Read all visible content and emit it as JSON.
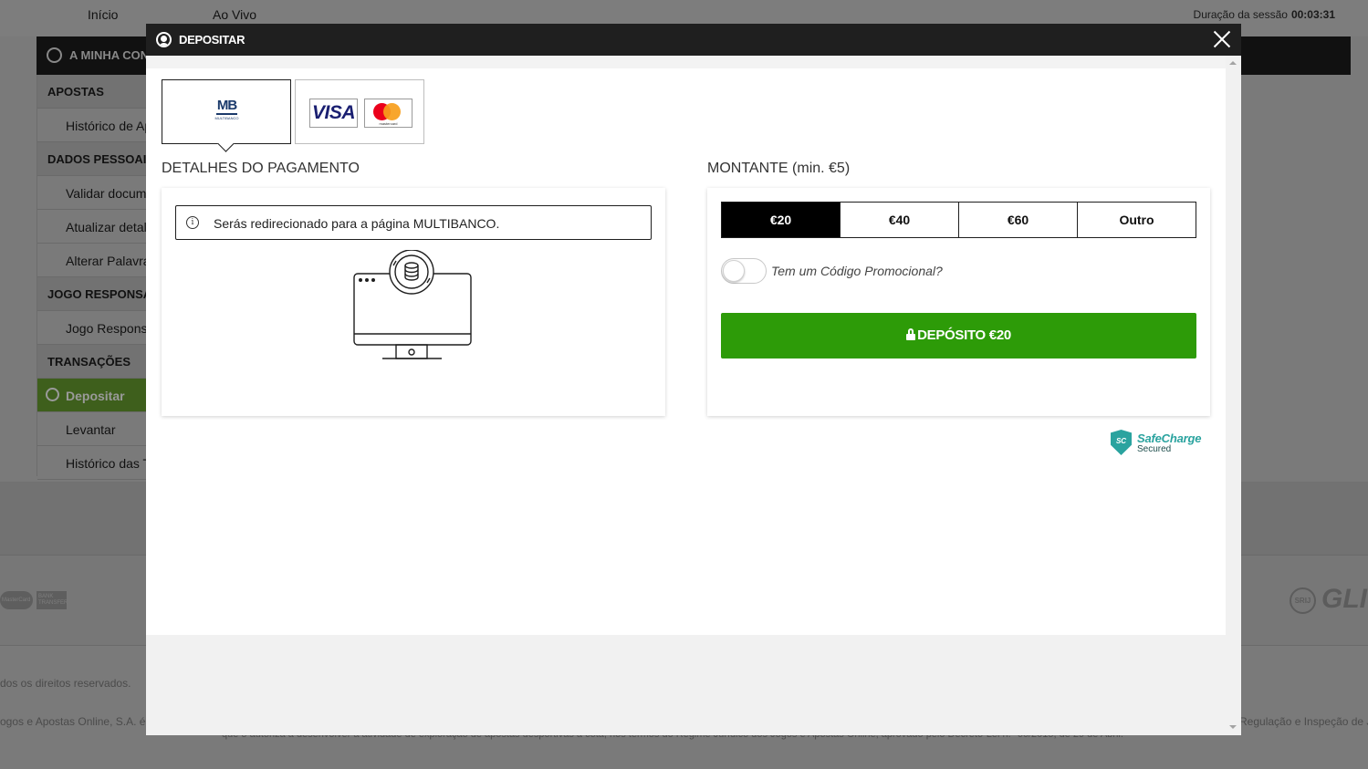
{
  "background": {
    "nav": [
      "Início",
      "Ao Vivo"
    ],
    "session_label": "Duração da sessão",
    "session_time": "00:03:31",
    "account_title": "A MINHA CONTA",
    "sidebar": [
      {
        "label": "APOSTAS",
        "type": "head"
      },
      {
        "label": "Histórico de Apostas",
        "type": "item"
      },
      {
        "label": "DADOS PESSOAIS",
        "type": "head"
      },
      {
        "label": "Validar documentos",
        "type": "item"
      },
      {
        "label": "Atualizar detalhes",
        "type": "item"
      },
      {
        "label": "Alterar Palavra-passe",
        "type": "item"
      },
      {
        "label": "JOGO RESPONSÁVEL",
        "type": "head"
      },
      {
        "label": "Jogo Responsável",
        "type": "item"
      },
      {
        "label": "TRANSAÇÕES",
        "type": "head"
      },
      {
        "label": "Depositar",
        "type": "active"
      },
      {
        "label": "Levantar",
        "type": "item"
      },
      {
        "label": "Histórico das Transações",
        "type": "item"
      }
    ],
    "footer_rights": "dos os direitos reservados.",
    "footer_legal_left": "ogos e Apostas Online, S.A. é u",
    "footer_legal_right": "Regulação e Inspeção de Jo",
    "footer_legal_faded": "que o autoriza a desenvolver a atividade de exploração de apostas desportivas à cota, nos termos do Regime Jurídico dos Jogos e Apostas Online, aprovado pelo Decreto-Lei n.º 66/2015, de 29 de Abril.",
    "mastercard_label": "MasterCard",
    "bank_label": "BANK TRANSFER",
    "gli_label": "GLI",
    "srij_label": "SRIJ"
  },
  "modal": {
    "title": "DEPOSITAR",
    "payment_methods": [
      {
        "name": "Multibanco",
        "logo_text": "MB",
        "logo_sub": "MULTIBANCO",
        "selected": true
      },
      {
        "name": "Visa / Mastercard",
        "visa": "VISA",
        "mastercard": "mastercard",
        "selected": false
      }
    ],
    "payment_details_title": "DETALHES DO PAGAMENTO",
    "info_message": "Serás redirecionado para a página MULTIBANCO.",
    "amount_title": "MONTANTE (min. €5)",
    "amounts": [
      "€20",
      "€40",
      "€60",
      "Outro"
    ],
    "selected_amount": "€20",
    "promo_label": "Tem um Código Promocional?",
    "promo_enabled": false,
    "deposit_button": "DEPÓSITO €20",
    "safecharge_name": "SafeCharge",
    "safecharge_sub": "Secured",
    "safecharge_badge": "SC"
  },
  "colors": {
    "deposit_green": "#2d9b08",
    "header_dark": "#1f1f1f",
    "safecharge_teal": "#2aa39f",
    "active_sidebar_green": "#3e5f1c"
  }
}
